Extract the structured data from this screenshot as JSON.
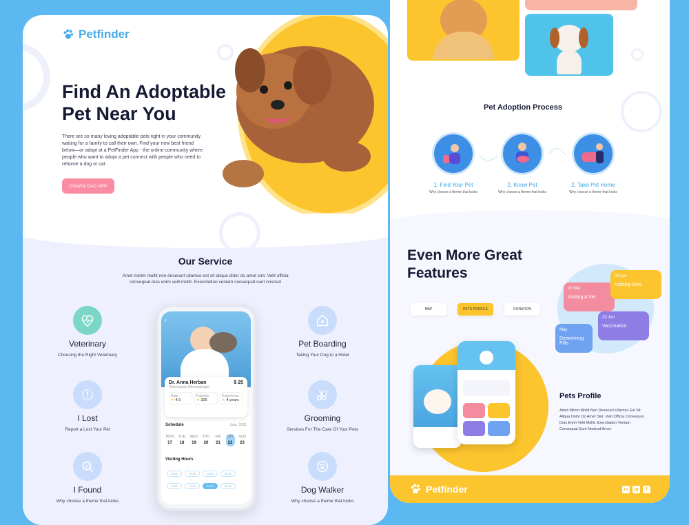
{
  "brand": {
    "name": "Petfinder"
  },
  "hero": {
    "title": "Find An Adoptable Pet Near You",
    "text": "There are so many loving adoptable pets right in your community waiting for a family to call their own. Find your new best friend below—or adopt at a PetFinder App - the online community where people who want to adopt a pet connect with people who need to rehome a dog or cat.",
    "cta": "DOWNLOAD APP"
  },
  "services": {
    "title": "Our Service",
    "subtitle": "Amet minim mollit non deserunt ullamco est sit aliqua dolor do amet sint. Velit officia consequat duis enim velit mollit. Exercitation veniam consequat sunt nostrud",
    "left": [
      {
        "title": "Veterinary",
        "desc": "Choosing the Right Veterinary",
        "icon": "heartbeat-icon"
      },
      {
        "title": "I Lost",
        "desc": "Report a Lost Your Pet",
        "icon": "alert-icon"
      },
      {
        "title": "I Found",
        "desc": "Why choose a theme that looks",
        "icon": "search-icon"
      }
    ],
    "right": [
      {
        "title": "Pet Boarding",
        "desc": "Taking Your Dog to a Hotel",
        "icon": "house-icon"
      },
      {
        "title": "Grooming",
        "desc": "Services For The Care Of Your Pets",
        "icon": "scissors-icon"
      },
      {
        "title": "Dog Walker",
        "desc": "Why choose a theme that looks",
        "icon": "paw-icon"
      }
    ]
  },
  "phone": {
    "doctor_name": "Dr. Anna Herban",
    "doctor_role": "Veterinarian Dermatologist",
    "price": "$ 25",
    "stats": [
      {
        "label": "Rate",
        "value": "4.9"
      },
      {
        "label": "Patients",
        "value": "325"
      },
      {
        "label": "Experience",
        "value": "4 years"
      }
    ],
    "schedule_label": "Schedule",
    "schedule_month": "June, 2021",
    "days": [
      {
        "d": "MON",
        "n": "17"
      },
      {
        "d": "TUE",
        "n": "18"
      },
      {
        "d": "WED",
        "n": "19"
      },
      {
        "d": "THU",
        "n": "20"
      },
      {
        "d": "FRI",
        "n": "21"
      },
      {
        "d": "SAT",
        "n": "22"
      },
      {
        "d": "SUN",
        "n": "23"
      }
    ],
    "visiting_label": "Visiting Hours",
    "hours": [
      "09:00",
      "09:30",
      "10:00",
      "10:30",
      "11:00",
      "11:30",
      "12:00",
      "12:30"
    ]
  },
  "process": {
    "title": "Pet Adoption Process",
    "steps": [
      {
        "label": "1. Find Your Pet",
        "desc": "Why choose a theme that looks"
      },
      {
        "label": "2. Know Pet",
        "desc": "Why choose a theme that looks"
      },
      {
        "label": "2. Take Pet Home",
        "desc": "Why choose a theme that looks"
      }
    ]
  },
  "features": {
    "title": "Even More Great Features",
    "tabs": [
      "MAP",
      "PETS PROFILE",
      "DONATION"
    ],
    "cards": [
      {
        "date": "20 Mar",
        "label": "Visiting A Vet"
      },
      {
        "date": "24 Apr",
        "label": "Visiting Groo"
      },
      {
        "date": "23 Jun",
        "label": "Vaccination"
      },
      {
        "date": "May",
        "label": "Deworming Pills"
      }
    ],
    "profile_title": "Pets Profile",
    "profile_text": "Amet Minim Mollit Non Deserunt Ullamco Est Sit Aliqua Dolor Do Amet Sint. Velit Officia Consequat Duis Enim Velit Mollit. Exercitation Veniam Consequat Sunt Nostrud Amet."
  },
  "footer": {
    "brand": "Petfinder",
    "social": [
      "in",
      "ig",
      "f"
    ]
  },
  "colors": {
    "accent": "#46a9e8",
    "yellow": "#fcc42d",
    "pink": "#fb8ba3",
    "teal": "#7ad7c5"
  }
}
